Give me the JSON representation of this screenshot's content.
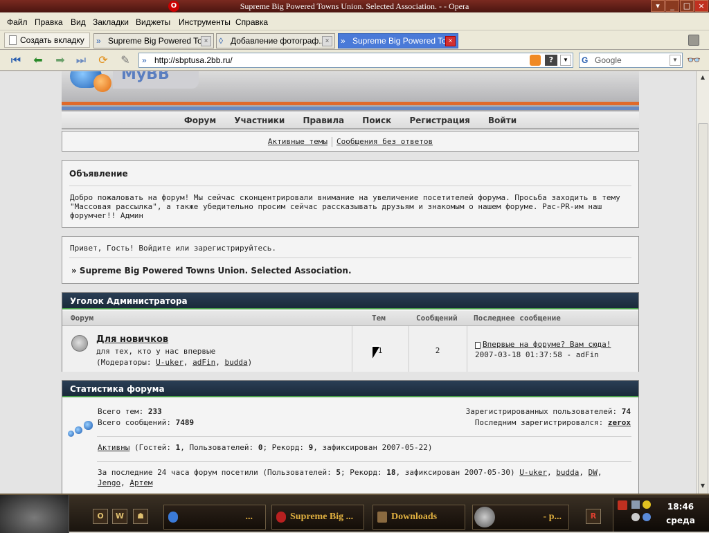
{
  "window": {
    "title": "Supreme Big Powered Towns Union. Selected Association. -       - Opera"
  },
  "menu": [
    "Файл",
    "Правка",
    "Вид",
    "Закладки",
    "Виджеты",
    "Инструменты",
    "Справка"
  ],
  "tabs": {
    "new_tab": "Создать вкладку",
    "items": [
      {
        "label": "Supreme Big Powered To..."
      },
      {
        "label": "Добавление фотограф..."
      },
      {
        "label": "Supreme Big Powered To..."
      }
    ]
  },
  "address": {
    "url": "http://sbptusa.2bb.ru/"
  },
  "search": {
    "engine": "Google"
  },
  "forum": {
    "logo_text": "MyBB",
    "nav": [
      "Форум",
      "Участники",
      "Правила",
      "Поиск",
      "Регистрация",
      "Войти"
    ],
    "quick_links": [
      "Активные темы",
      "Сообщения без ответов"
    ],
    "notice": {
      "title": "Объявление",
      "line1": "Добро пожаловать на форум! Мы сейчас сконцентрировали внимание на увеличение посетителей форума. Просьба заходить в тему",
      "line2": "\"Массовая рассылка\", а также убедительно просим сейчас рассказывать друзьям и знакомым о нашем форуме. Рас-PR-им наш",
      "line3": "форумчег!! Админ"
    },
    "guest": {
      "greeting": "Привет, Гость!  Войдите или зарегистрируйтесь.",
      "board_title": "» Supreme Big Powered Towns Union. Selected Association."
    },
    "category": {
      "title": "Уголок Администратора",
      "columns": [
        "Форум",
        "Тем",
        "Сообщений",
        "Последнее сообщение"
      ],
      "forums": [
        {
          "name": "Для новичков",
          "desc": "для тех, кто у нас впервые",
          "moderators_label": "(Модераторы:",
          "moderators": [
            "U-uker",
            "adFin",
            "budda"
          ],
          "topics": "1",
          "posts": "2",
          "last_post_title": "Впервые на форуме? Вам сюда!",
          "last_post_meta": "2007-03-18 01:37:58 - adFin"
        }
      ]
    },
    "stats": {
      "title": "Статистика форума",
      "topics_label": "Всего тем:",
      "topics": "233",
      "posts_label": "Всего сообщений:",
      "posts": "7489",
      "users_label": "Зарегистрированных пользователей:",
      "users": "74",
      "last_reg_label": "Последним зарегистрировался:",
      "last_reg": "zerox",
      "active": {
        "link": "Активны",
        "text1": " (Гостей: ",
        "guests": "1",
        "text2": ", Пользователей: ",
        "users": "0",
        "text3": "; Рекорд: ",
        "record": "9",
        "text4": ", зафиксирован 2007-05-22)"
      },
      "day": {
        "text1": "За последние 24 часа форум посетили (Пользователей: ",
        "users": "5",
        "text2": "; Рекорд: ",
        "record": "18",
        "text3": ", зафиксирован 2007-05-30) ",
        "names": [
          "U-uker",
          "budda",
          "DW",
          "Jengo",
          "Артем"
        ]
      }
    }
  },
  "taskbar": {
    "buttons": [
      "...",
      "Supreme Big ...",
      "Downloads",
      "- p..."
    ],
    "time": "18:46",
    "day": "среда"
  }
}
